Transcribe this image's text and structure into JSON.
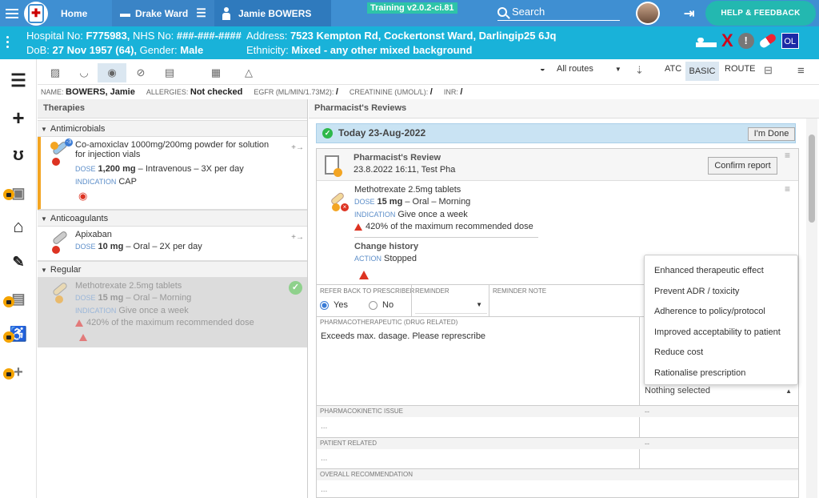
{
  "topbar": {
    "home_label": "Home",
    "ward_label": "Drake Ward",
    "patient_label": "Jamie BOWERS",
    "training_badge": "Training v2.0.2-ci.81",
    "search_placeholder": "Search",
    "help_label": "HELP & FEEDBACK"
  },
  "banner": {
    "hospital_no_label": "Hospital No:",
    "hospital_no": "F775983,",
    "nhs_label": "NHS No:",
    "nhs_no": "###-###-####",
    "address_label": "Address:",
    "address": "7523 Kempton Rd, Cockertonst Ward, Darlingip25 6Jq",
    "dob_label": "DoB:",
    "dob": "27 Nov 1957 (64),",
    "gender_label": "Gender:",
    "gender": "Male",
    "ethnicity_label": "Ethnicity:",
    "ethnicity": "Mixed - any other mixed background",
    "ol_badge": "OL"
  },
  "toolbar": {
    "routes_label": "All routes",
    "atc": "ATC",
    "basic": "BASIC",
    "route": "ROUTE"
  },
  "patient_row": {
    "name_label": "NAME:",
    "name": "BOWERS, Jamie",
    "allergies_label": "ALLERGIES:",
    "allergies": "Not checked",
    "egfr_label": "EGFR (ML/MIN/1.73M2):",
    "egfr": "/",
    "creatinine_label": "CREATININE (UMOL/L):",
    "creatinine": "/",
    "inr_label": "INR:",
    "inr": "/"
  },
  "therapies": {
    "title": "Therapies",
    "groups": [
      {
        "name": "Antimicrobials",
        "items": [
          {
            "name_line1": "Co-amoxiclav 1000mg/200mg powder for solution",
            "name_line2": "for injection vials",
            "dose_label": "DOSE",
            "dose": "1,200 mg",
            "dose_rest": "– Intravenous – 3X per day",
            "indication_label": "INDICATION",
            "indication": "CAP",
            "badge": "-3"
          }
        ]
      },
      {
        "name": "Anticoagulants",
        "items": [
          {
            "name_line1": "Apixaban",
            "dose_label": "DOSE",
            "dose": "10 mg",
            "dose_rest": "– Oral – 2X per day"
          }
        ]
      },
      {
        "name": "Regular",
        "items": [
          {
            "name_line1": "Methotrexate 2.5mg tablets",
            "dose_label": "DOSE",
            "dose": "15 mg",
            "dose_rest": "– Oral – Morning",
            "indication_label": "INDICATION",
            "indication": "Give once a week",
            "warning": "420% of the maximum recommended dose"
          }
        ]
      }
    ]
  },
  "reviews": {
    "title": "Pharmacist's Reviews",
    "today_label": "Today 23-Aug-2022",
    "im_done": "I'm Done",
    "card_title": "Pharmacist's Review",
    "card_subtitle": "23.8.2022 16:11, Test Pha",
    "confirm_label": "Confirm report",
    "drug_name": "Methotrexate 2.5mg tablets",
    "dose_label": "DOSE",
    "dose": "15 mg",
    "dose_rest": "– Oral – Morning",
    "indication_label": "INDICATION",
    "indication": "Give once a week",
    "warning": "420% of the maximum recommended dose",
    "change_history": "Change history",
    "action_label": "ACTION",
    "action": "Stopped",
    "refer_back_label": "REFER BACK TO PRESCRIBER",
    "reminder_label": "REMINDER",
    "reminder_note_label": "REMINDER NOTE",
    "yes_label": "Yes",
    "no_label": "No",
    "pharmacotherapeutic_label": "PHARMACOTHERAPEUTIC (DRUG RELATED)",
    "pharmacotherapeutic_text": "Exceeds max. dasage. Please represcribe",
    "pharmacokinetic_label": "PHARMACOKINETIC ISSUE",
    "patient_related_label": "PATIENT RELATED",
    "overall_label": "OVERALL RECOMMENDATION",
    "placeholder_dots": "...",
    "dash": "--",
    "nothing_selected": "Nothing selected"
  },
  "dropdown_options": [
    "Enhanced therapeutic effect",
    "Prevent ADR / toxicity",
    "Adherence to policy/protocol",
    "Improved acceptability to patient",
    "Reduce cost",
    "Rationalise prescription"
  ],
  "colors": {
    "topbar": "#3f8fd2",
    "banner": "#19b2d9",
    "help_button": "#23b8b0",
    "training_badge": "#2ec4a8",
    "accent_blue": "#3a7bd5",
    "warning_red": "#d32f2f",
    "therapy_highlight": "#f3a523"
  },
  "icons": [
    "hamburger-icon",
    "hospital-logo-icon",
    "bed-icon",
    "person-icon",
    "search-icon",
    "logout-icon",
    "x-icon",
    "alert-icon",
    "pill-icon",
    "list-icon",
    "plus-icon",
    "stethoscope-icon",
    "camera-icon",
    "home-icon",
    "edit-icon",
    "badge-icon",
    "person-walk-icon",
    "add-icon",
    "eye-icon",
    "warning-icon"
  ]
}
